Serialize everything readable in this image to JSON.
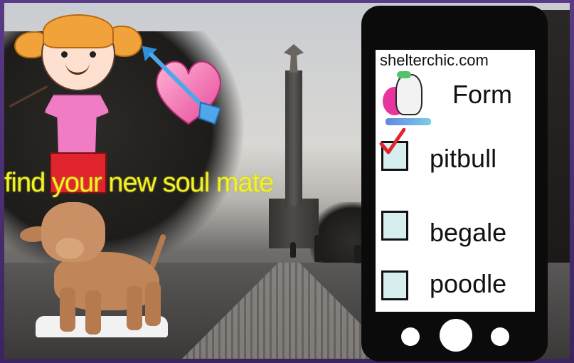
{
  "scene": {
    "tagline": "find your new soul mate"
  },
  "phone": {
    "site": "shelterchic.com",
    "form_title": "Form",
    "options": [
      {
        "label": "pitbull",
        "checked": true
      },
      {
        "label": "begale",
        "checked": false
      },
      {
        "label": "poodle",
        "checked": false
      }
    ]
  },
  "colors": {
    "tagline": "#f1f12a",
    "checkbox_fill": "#d6eeee",
    "check_mark": "#e0242e",
    "frame": "#4a2a6a"
  }
}
